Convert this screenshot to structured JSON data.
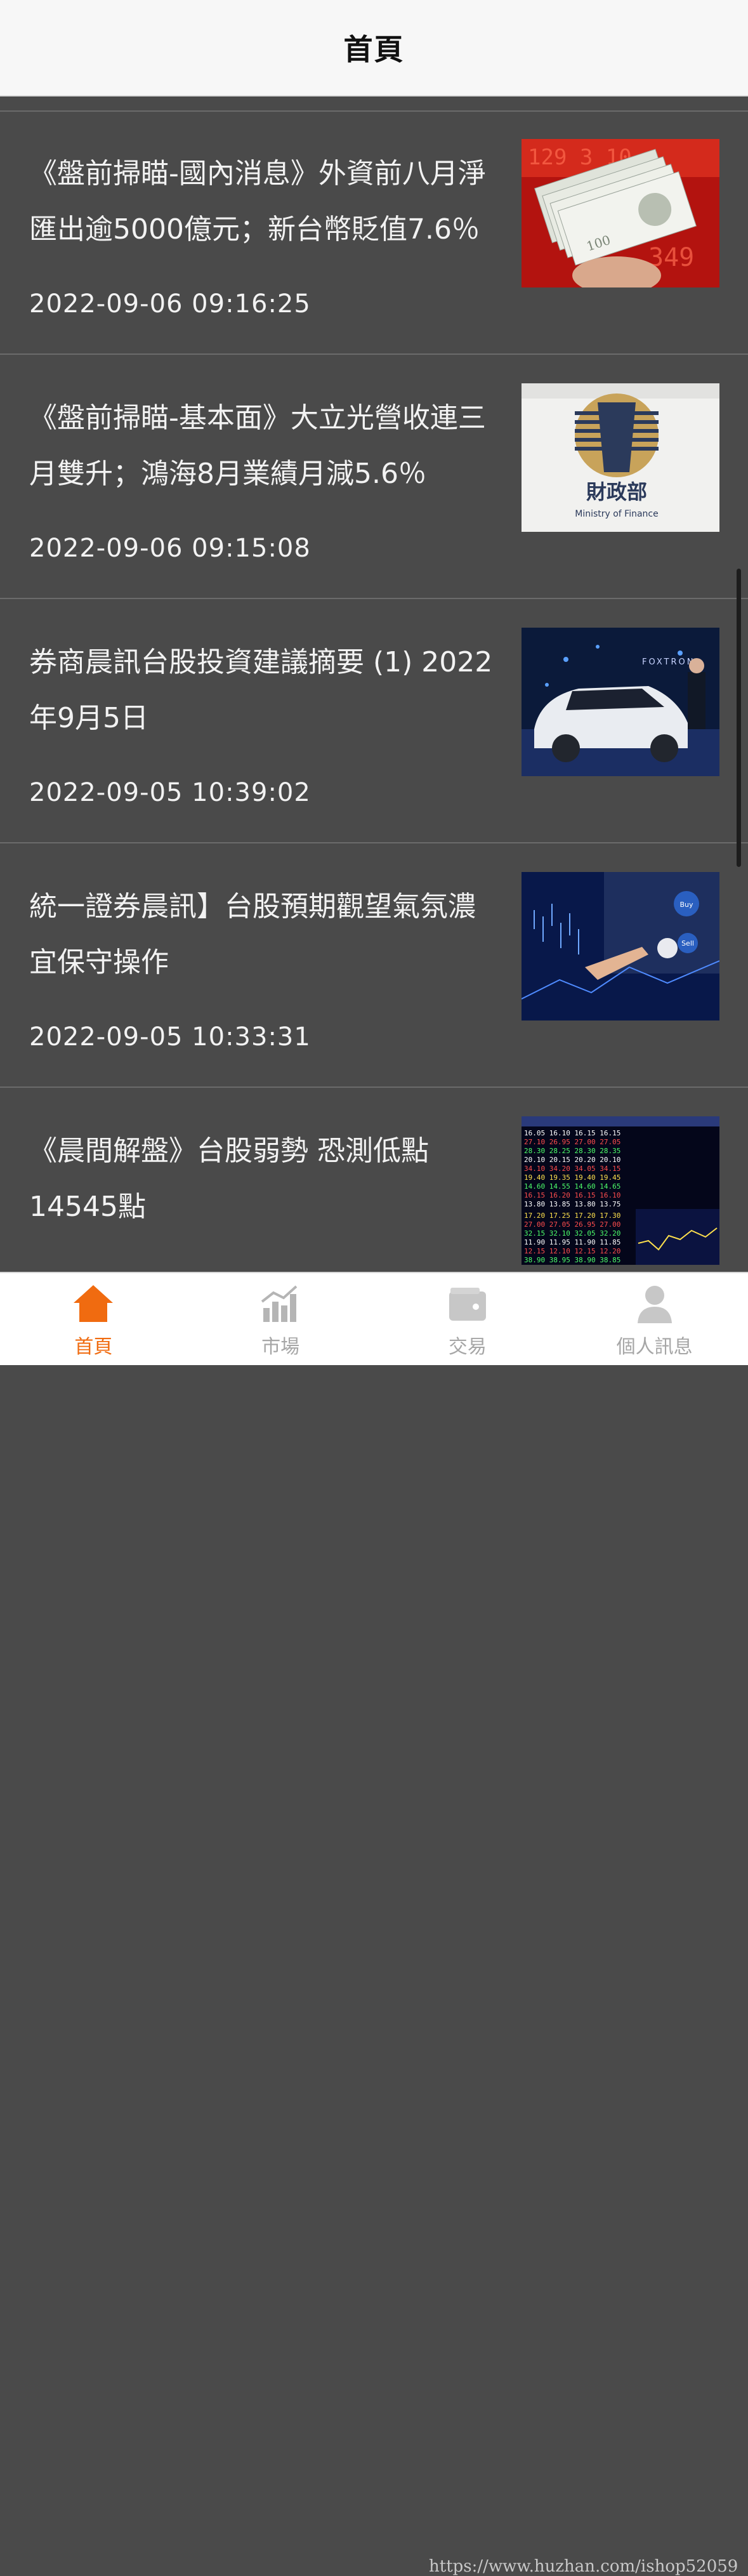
{
  "header": {
    "title": "首頁"
  },
  "news": [
    {
      "headline": "《盤前掃瞄-國內消息》外資前八月淨匯出逾5000億元；新台幣貶值7.6％",
      "time": "2022-09-06 09:16:25",
      "thumb_icon": "money-banknotes-image"
    },
    {
      "headline": "《盤前掃瞄-基本面》大立光營收連三月雙升；鴻海8月業績月減5.6％",
      "time": "2022-09-06 09:15:08",
      "thumb_icon": "ministry-of-finance-image",
      "thumb_text": {
        "name": "財政部",
        "sub": "Ministry of Finance"
      }
    },
    {
      "headline": "券商晨訊台股投資建議摘要 (1) 2022年9月5日",
      "time": "2022-09-05 10:39:02",
      "thumb_icon": "foxtron-car-launch-image",
      "thumb_text": {
        "brand": "FOXTRON"
      }
    },
    {
      "headline": "統一證券晨訊】台股預期觀望氣氛濃 宜保守操作",
      "time": "2022-09-05 10:33:31",
      "thumb_icon": "stock-chart-touch-image",
      "thumb_text": {
        "buy": "Buy",
        "sell": "Sell"
      }
    },
    {
      "headline": "《晨間解盤》台股弱勢 恐測低點14545點",
      "time": "",
      "thumb_icon": "stock-quote-board-image"
    }
  ],
  "tabs": [
    {
      "label": "首頁",
      "icon": "home-icon",
      "active": true
    },
    {
      "label": "市場",
      "icon": "market-chart-icon",
      "active": false
    },
    {
      "label": "交易",
      "icon": "wallet-icon",
      "active": false
    },
    {
      "label": "個人訊息",
      "icon": "user-icon",
      "active": false
    }
  ],
  "watermark": "https://www.huzhan.com/ishop52059",
  "colors": {
    "accent": "#f06b10",
    "inactive": "#a6a6a6",
    "feed_bg": "#4a4a4a",
    "header_bg": "#f7f7f7"
  }
}
